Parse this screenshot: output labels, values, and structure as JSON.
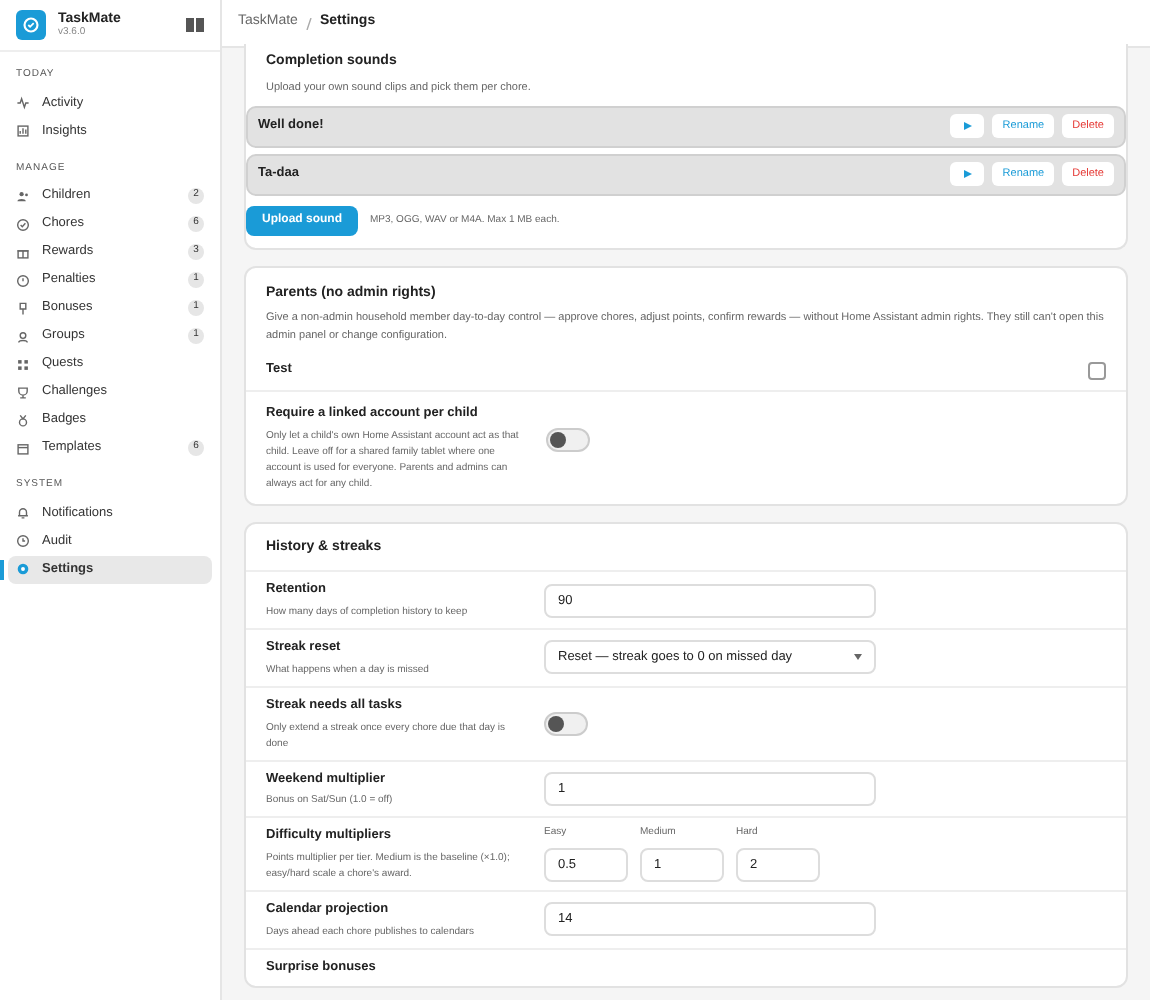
{
  "sidebar": {
    "app_name": "TaskMate",
    "version": "v3.6.0",
    "sections": [
      {
        "title": "TODAY",
        "items": [
          {
            "label": "Activity",
            "selected": false
          },
          {
            "label": "Insights",
            "selected": false
          }
        ]
      },
      {
        "title": "MANAGE",
        "items": [
          {
            "label": "Children",
            "count": "2",
            "selected": false
          },
          {
            "label": "Chores",
            "count": "6",
            "selected": false
          },
          {
            "label": "Rewards",
            "count": "3",
            "selected": false
          },
          {
            "label": "Penalties",
            "count": "1",
            "selected": false
          },
          {
            "label": "Bonuses",
            "count": "1",
            "selected": false
          },
          {
            "label": "Groups",
            "count": "1",
            "selected": false
          },
          {
            "label": "Quests",
            "selected": false
          },
          {
            "label": "Challenges",
            "selected": false
          },
          {
            "label": "Badges",
            "selected": false
          },
          {
            "label": "Templates",
            "count": "6",
            "selected": false
          }
        ]
      },
      {
        "title": "SYSTEM",
        "items": [
          {
            "label": "Notifications",
            "selected": false
          },
          {
            "label": "Audit",
            "selected": false
          },
          {
            "label": "Settings",
            "selected": true
          }
        ]
      }
    ]
  },
  "breadcrumb": [
    "TaskMate",
    "Settings"
  ],
  "sounds": {
    "title": "Completion sounds",
    "description": "Upload your own sound clips and pick them per chore.",
    "items": [
      {
        "name": "Well done!",
        "rename": "Rename",
        "delete": "Delete"
      },
      {
        "name": "Ta-daa",
        "rename": "Rename",
        "delete": "Delete"
      }
    ],
    "upload_button": "Upload sound",
    "upload_hint": "MP3, OGG, WAV or M4A. Max 1 MB each."
  },
  "parents": {
    "title": "Parents (no admin rights)",
    "description": "Give a non-admin household member day-to-day control — approve chores, adjust points, confirm rewards — without Home Assistant admin rights. They still can't open this admin panel or change configuration.",
    "rows": [
      {
        "kind": "checkbox",
        "label": "Test",
        "checked": false
      },
      {
        "kind": "toggle",
        "label": "Require a linked account per child",
        "description": "Only let a child's own Home Assistant account act as that child. Leave off for a shared family tablet where one account is used for everyone. Parents and admins can always act for any child.",
        "on": false
      }
    ]
  },
  "history": {
    "title": "History & streaks",
    "rows": [
      {
        "kind": "input",
        "label": "Retention",
        "description": "How many days of completion history to keep",
        "value": "90"
      },
      {
        "kind": "select",
        "label": "Streak reset",
        "description": "What happens when a day is missed",
        "value": "Reset — streak goes to 0 on missed day"
      },
      {
        "kind": "toggle",
        "label": "Streak needs all tasks",
        "description": "Only extend a streak once every chore due that day is done",
        "on": false
      },
      {
        "kind": "input",
        "label": "Weekend multiplier",
        "description": "Bonus on Sat/Sun (1.0 = off)",
        "value": "1"
      },
      {
        "kind": "multi",
        "label": "Difficulty multipliers",
        "description": "Points multiplier per tier. Medium is the baseline (×1.0); easy/hard scale a chore's award.",
        "fields": [
          {
            "label": "Easy",
            "value": "0.5"
          },
          {
            "label": "Medium",
            "value": "1"
          },
          {
            "label": "Hard",
            "value": "2"
          }
        ]
      },
      {
        "kind": "input",
        "label": "Calendar projection",
        "description": "Days ahead each chore publishes to calendars",
        "value": "14"
      },
      {
        "kind": "cut",
        "label": "Surprise bonuses"
      }
    ]
  }
}
